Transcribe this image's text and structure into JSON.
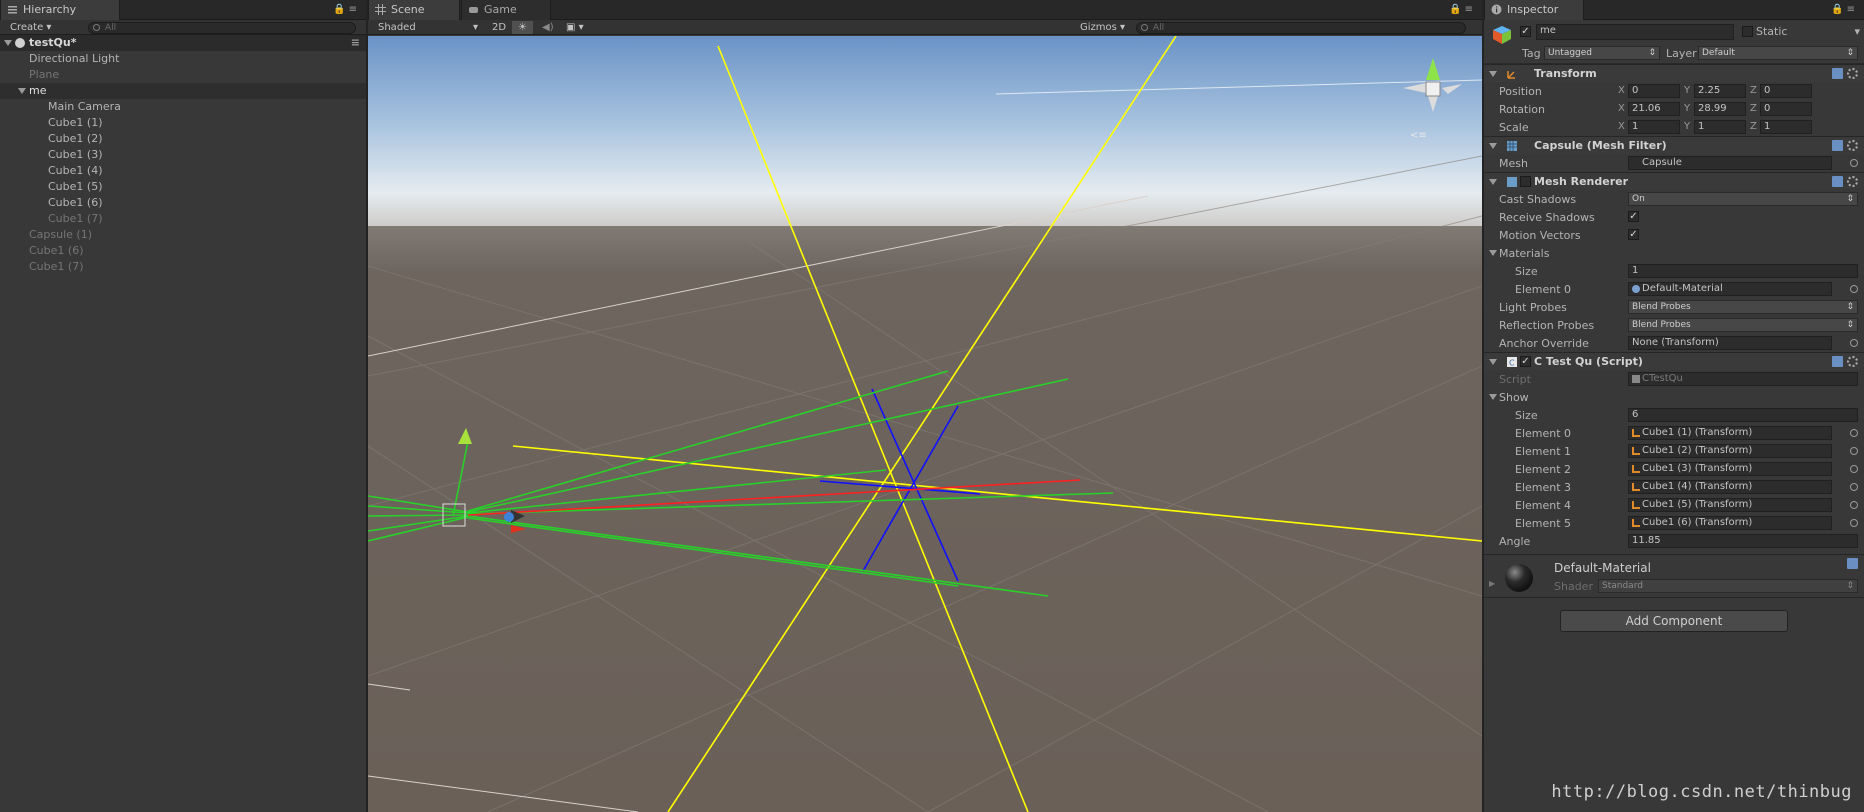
{
  "hierarchy": {
    "tab_label": "Hierarchy",
    "create_label": "Create",
    "search_placeholder": "All",
    "scene_name": "testQu*",
    "rows": [
      {
        "label": "Directional Light",
        "indent": 1,
        "dim": false,
        "selected": false,
        "fold": false
      },
      {
        "label": "Plane",
        "indent": 1,
        "dim": true,
        "selected": false,
        "fold": false
      },
      {
        "label": "me",
        "indent": 1,
        "dim": false,
        "selected": true,
        "fold": true
      },
      {
        "label": "Main Camera",
        "indent": 2,
        "dim": false,
        "selected": false,
        "fold": false
      },
      {
        "label": "Cube1 (1)",
        "indent": 2,
        "dim": false,
        "selected": false,
        "fold": false
      },
      {
        "label": "Cube1 (2)",
        "indent": 2,
        "dim": false,
        "selected": false,
        "fold": false
      },
      {
        "label": "Cube1 (3)",
        "indent": 2,
        "dim": false,
        "selected": false,
        "fold": false
      },
      {
        "label": "Cube1 (4)",
        "indent": 2,
        "dim": false,
        "selected": false,
        "fold": false
      },
      {
        "label": "Cube1 (5)",
        "indent": 2,
        "dim": false,
        "selected": false,
        "fold": false
      },
      {
        "label": "Cube1 (6)",
        "indent": 2,
        "dim": false,
        "selected": false,
        "fold": false
      },
      {
        "label": "Cube1 (7)",
        "indent": 2,
        "dim": true,
        "selected": false,
        "fold": false
      },
      {
        "label": "Capsule (1)",
        "indent": 1,
        "dim": true,
        "selected": false,
        "fold": false
      },
      {
        "label": "Cube1 (6)",
        "indent": 1,
        "dim": true,
        "selected": false,
        "fold": false
      },
      {
        "label": "Cube1 (7)",
        "indent": 1,
        "dim": true,
        "selected": false,
        "fold": false
      }
    ]
  },
  "scene": {
    "tab_scene": "Scene",
    "tab_game": "Game",
    "shading_mode": "Shaded",
    "mode_2d": "2D",
    "gizmos_label": "Gizmos",
    "search_placeholder": "All"
  },
  "inspector": {
    "tab_label": "Inspector",
    "object_name": "me",
    "static_label": "Static",
    "tag_label": "Tag",
    "tag_value": "Untagged",
    "layer_label": "Layer",
    "layer_value": "Default",
    "transform": {
      "title": "Transform",
      "position_label": "Position",
      "position": [
        "0",
        "2.25",
        "0"
      ],
      "rotation_label": "Rotation",
      "rotation": [
        "21.06",
        "28.99",
        "0"
      ],
      "scale_label": "Scale",
      "scale": [
        "1",
        "1",
        "1"
      ],
      "axis_labels": [
        "X",
        "Y",
        "Z"
      ]
    },
    "mesh_filter": {
      "title": "Capsule (Mesh Filter)",
      "mesh_label": "Mesh",
      "mesh_value": "Capsule"
    },
    "mesh_renderer": {
      "title": "Mesh Renderer",
      "cast_shadows_label": "Cast Shadows",
      "cast_shadows_value": "On",
      "receive_shadows_label": "Receive Shadows",
      "motion_vectors_label": "Motion Vectors",
      "materials_label": "Materials",
      "size_label": "Size",
      "size_value": "1",
      "element0_label": "Element 0",
      "element0_value": "Default-Material",
      "light_probes_label": "Light Probes",
      "light_probes_value": "Blend Probes",
      "reflection_probes_label": "Reflection Probes",
      "reflection_probes_value": "Blend Probes",
      "anchor_label": "Anchor Override",
      "anchor_value": "None (Transform)"
    },
    "script": {
      "title": "C Test Qu (Script)",
      "script_label": "Script",
      "script_value": "CTestQu",
      "show_label": "Show",
      "size_label": "Size",
      "size_value": "6",
      "elements": [
        {
          "label": "Element 0",
          "value": "Cube1 (1) (Transform)"
        },
        {
          "label": "Element 1",
          "value": "Cube1 (2) (Transform)"
        },
        {
          "label": "Element 2",
          "value": "Cube1 (3) (Transform)"
        },
        {
          "label": "Element 3",
          "value": "Cube1 (4) (Transform)"
        },
        {
          "label": "Element 4",
          "value": "Cube1 (5) (Transform)"
        },
        {
          "label": "Element 5",
          "value": "Cube1 (6) (Transform)"
        }
      ],
      "angle_label": "Angle",
      "angle_value": "11.85"
    },
    "material": {
      "name": "Default-Material",
      "shader_label": "Shader",
      "shader_value": "Standard"
    },
    "add_component_label": "Add Component"
  },
  "watermark": "http://blog.csdn.net/thinbug",
  "colors": {
    "panel": "#383838",
    "sky_top": "#6e95c6",
    "ground": "#6a615a",
    "axis_yellow": "#ffff00",
    "axis_blue": "#0000ff",
    "ray_green": "#22dd22",
    "ray_red": "#ff2020"
  }
}
